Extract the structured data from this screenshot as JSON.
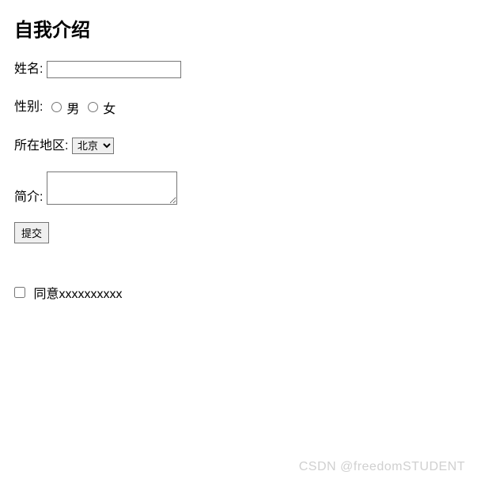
{
  "heading": "自我介绍",
  "fields": {
    "name": {
      "label": "姓名:",
      "value": ""
    },
    "gender": {
      "label": "性别:",
      "options": {
        "male": "男",
        "female": "女"
      }
    },
    "region": {
      "label": "所在地区:",
      "selected": "北京"
    },
    "bio": {
      "label": "简介:",
      "value": ""
    }
  },
  "submit_label": "提交",
  "agree": {
    "label": "同意xxxxxxxxxx"
  },
  "watermark": "CSDN @freedomSTUDENT"
}
